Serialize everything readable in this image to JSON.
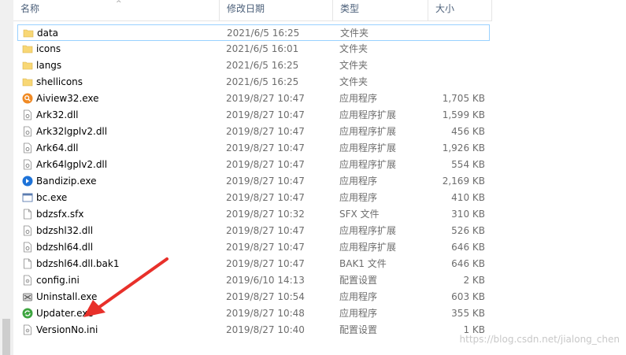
{
  "columns": {
    "name": "名称",
    "date": "修改日期",
    "type": "类型",
    "size": "大小",
    "sort_indicator": "^"
  },
  "files": [
    {
      "name": "data",
      "date": "2021/6/5 16:25",
      "type": "文件夹",
      "size": "",
      "icon": "folder-icon",
      "selected": true
    },
    {
      "name": "icons",
      "date": "2021/6/5 16:01",
      "type": "文件夹",
      "size": "",
      "icon": "folder-icon"
    },
    {
      "name": "langs",
      "date": "2021/6/5 16:25",
      "type": "文件夹",
      "size": "",
      "icon": "folder-icon"
    },
    {
      "name": "shellicons",
      "date": "2021/6/5 16:25",
      "type": "文件夹",
      "size": "",
      "icon": "folder-icon"
    },
    {
      "name": "Aiview32.exe",
      "date": "2019/8/27 10:47",
      "type": "应用程序",
      "size": "1,705 KB",
      "icon": "aiview-app-icon"
    },
    {
      "name": "Ark32.dll",
      "date": "2019/8/27 10:47",
      "type": "应用程序扩展",
      "size": "1,599 KB",
      "icon": "dll-file-icon"
    },
    {
      "name": "Ark32lgplv2.dll",
      "date": "2019/8/27 10:47",
      "type": "应用程序扩展",
      "size": "456 KB",
      "icon": "dll-file-icon"
    },
    {
      "name": "Ark64.dll",
      "date": "2019/8/27 10:47",
      "type": "应用程序扩展",
      "size": "1,926 KB",
      "icon": "dll-file-icon"
    },
    {
      "name": "Ark64lgplv2.dll",
      "date": "2019/8/27 10:47",
      "type": "应用程序扩展",
      "size": "554 KB",
      "icon": "dll-file-icon"
    },
    {
      "name": "Bandizip.exe",
      "date": "2019/8/27 10:47",
      "type": "应用程序",
      "size": "2,169 KB",
      "icon": "bandizip-app-icon"
    },
    {
      "name": "bc.exe",
      "date": "2019/8/27 10:47",
      "type": "应用程序",
      "size": "410 KB",
      "icon": "exe-window-icon"
    },
    {
      "name": "bdzsfx.sfx",
      "date": "2019/8/27 10:32",
      "type": "SFX 文件",
      "size": "310 KB",
      "icon": "blank-file-icon"
    },
    {
      "name": "bdzshl32.dll",
      "date": "2019/8/27 10:47",
      "type": "应用程序扩展",
      "size": "526 KB",
      "icon": "dll-file-icon"
    },
    {
      "name": "bdzshl64.dll",
      "date": "2019/8/27 10:47",
      "type": "应用程序扩展",
      "size": "646 KB",
      "icon": "dll-file-icon"
    },
    {
      "name": "bdzshl64.dll.bak1",
      "date": "2019/8/27 10:47",
      "type": "BAK1 文件",
      "size": "646 KB",
      "icon": "blank-file-icon"
    },
    {
      "name": "config.ini",
      "date": "2019/6/10 14:13",
      "type": "配置设置",
      "size": "2 KB",
      "icon": "ini-file-icon"
    },
    {
      "name": "Uninstall.exe",
      "date": "2019/8/27 10:54",
      "type": "应用程序",
      "size": "603 KB",
      "icon": "uninstall-app-icon"
    },
    {
      "name": "Updater.exe",
      "date": "2019/8/27 10:48",
      "type": "应用程序",
      "size": "355 KB",
      "icon": "updater-app-icon"
    },
    {
      "name": "VersionNo.ini",
      "date": "2019/8/27 10:40",
      "type": "配置设置",
      "size": "1 KB",
      "icon": "ini-file-icon"
    }
  ],
  "watermark": "https://blog.csdn.net/jialong_chen",
  "colors": {
    "selection_border": "#99d1ff",
    "folder": "#f8d775",
    "arrow": "#e8302a"
  }
}
